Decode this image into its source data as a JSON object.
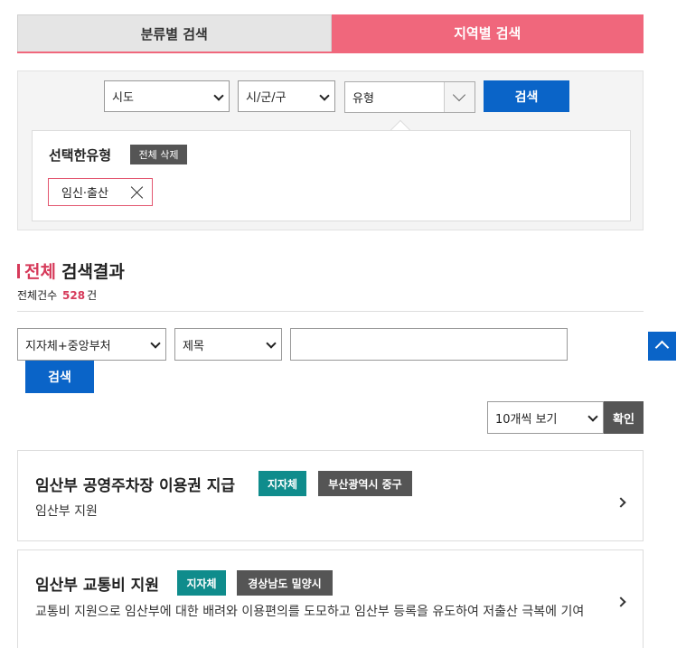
{
  "tabs": [
    {
      "label": "분류별 검색",
      "active": false
    },
    {
      "label": "지역별 검색",
      "active": true
    }
  ],
  "filters": {
    "sido": "시도",
    "sigungu": "시/군/구",
    "type": "유형",
    "search_label": "검색"
  },
  "selected": {
    "title": "선택한유형",
    "clear_all_label": "전체 삭제",
    "chips": [
      "임신·출산"
    ]
  },
  "results": {
    "heading_accent": "전체",
    "heading_rest": "검색결과",
    "count_prefix": "전체건수",
    "count": "528",
    "count_suffix": "건"
  },
  "search_bar": {
    "org_select": "지자체+중앙부처",
    "field_select": "제목",
    "query": "",
    "search_label": "검색"
  },
  "paging": {
    "per_page": "10개씩 보기",
    "confirm_label": "확인"
  },
  "items": [
    {
      "title": "임산부 공영주차장 이용권 지급",
      "tag1": "지자체",
      "tag2": "부산광역시 중구",
      "desc": "임산부 지원"
    },
    {
      "title": "임산부 교통비 지원",
      "tag1": "지자체",
      "tag2": "경상남도 밀양시",
      "desc": "교통비 지원으로 임산부에 대한 배려와 이용편의를 도모하고 임산부 등록을 유도하여 저출산 극복에 기여"
    }
  ],
  "colors": {
    "accent_pink": "#f0677c",
    "accent_red": "#d63a5a",
    "primary_blue": "#0a64c8",
    "tag_teal": "#0f8c8c",
    "tag_gray": "#555555"
  },
  "icons": {
    "chip_remove": "close-icon",
    "scroll_top": "chevron-up-icon",
    "item_arrow": "chevron-right-icon",
    "select_arrow": "chevron-down-icon"
  }
}
